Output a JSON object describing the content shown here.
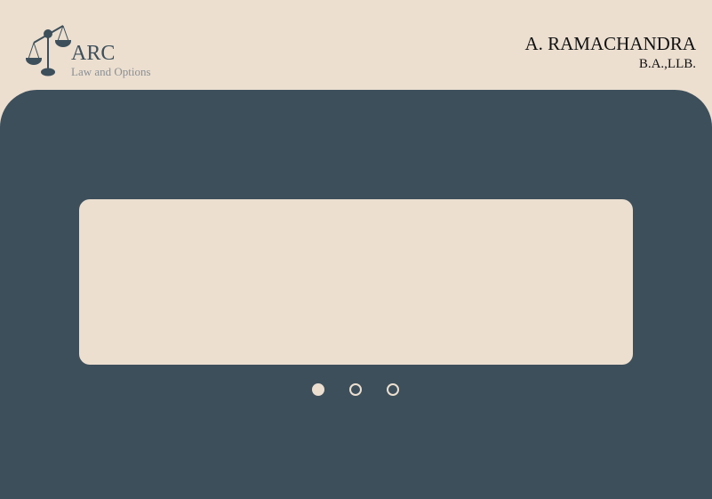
{
  "brand": {
    "name": "ARC",
    "tagline": "Law and Options"
  },
  "header": {
    "person": "A. RAMACHANDRA",
    "degree": "B.A.,LLB."
  },
  "carousel": {
    "slides": 3,
    "active": 0
  },
  "colors": {
    "bg": "#ecdfd0",
    "panel": "#3d4f5b"
  }
}
